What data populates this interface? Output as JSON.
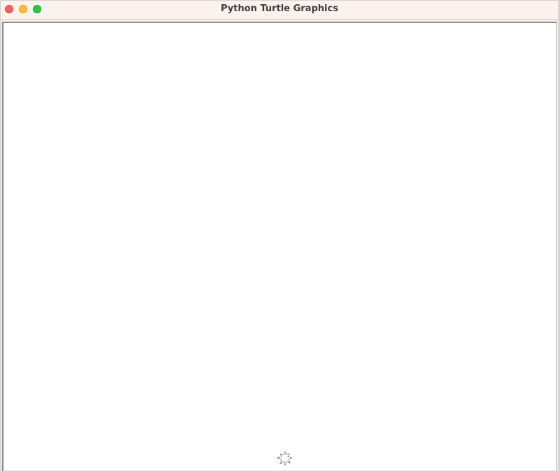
{
  "window": {
    "title": "Python Turtle Graphics",
    "controls": [
      "close",
      "minimize",
      "maximize"
    ]
  },
  "canvas": {
    "background": "#ffffff"
  },
  "turtle": {
    "icon": "turtle-icon",
    "fill": "#ffffff",
    "outline": "#000000"
  },
  "colors": {
    "titlebar": "#fbf2ee",
    "close": "#fe5f57",
    "minimize": "#febc2e",
    "maximize": "#28c840"
  }
}
